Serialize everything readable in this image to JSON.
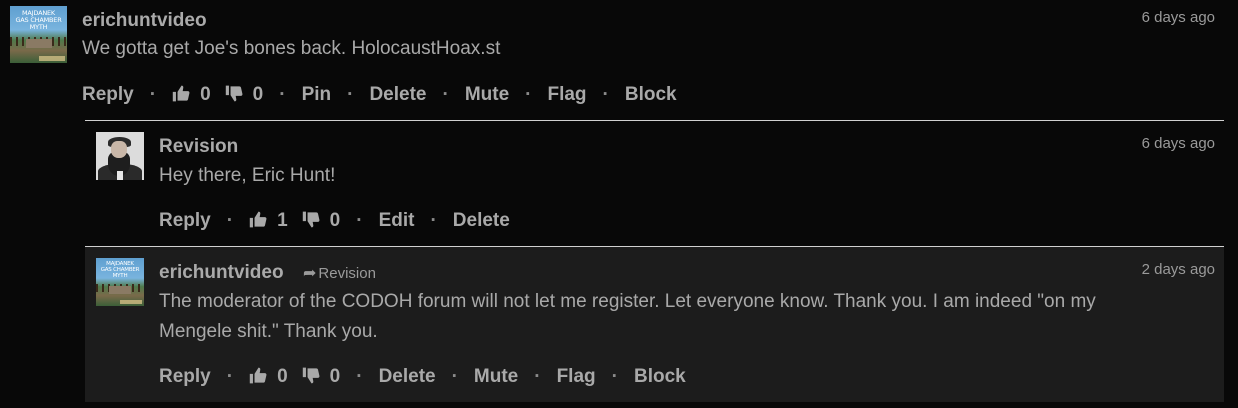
{
  "comments": [
    {
      "author": "erichuntvideo",
      "time": "6 days ago",
      "text": "We gotta get Joe's bones back. HolocaustHoax.st",
      "avatar_lines": [
        "MAJDANEK",
        "GAS CHAMBER",
        "MYTH"
      ],
      "actions": {
        "reply": "Reply",
        "likes": "0",
        "dislikes": "0",
        "pin": "Pin",
        "delete": "Delete",
        "mute": "Mute",
        "flag": "Flag",
        "block": "Block"
      }
    },
    {
      "author": "Revision",
      "time": "6 days ago",
      "text": "Hey there, Eric Hunt!",
      "actions": {
        "reply": "Reply",
        "likes": "1",
        "dislikes": "0",
        "edit": "Edit",
        "delete": "Delete"
      }
    },
    {
      "author": "erichuntvideo",
      "reply_to": "Revision",
      "time": "2 days ago",
      "text_lines": [
        "The moderator of the CODOH forum will not let me register. Let everyone know. Thank you. I am indeed \"on my",
        "Mengele shit.\" Thank you."
      ],
      "avatar_lines": [
        "MAJDANEK",
        "GAS CHAMBER",
        "MYTH"
      ],
      "actions": {
        "reply": "Reply",
        "likes": "0",
        "dislikes": "0",
        "delete": "Delete",
        "mute": "Mute",
        "flag": "Flag",
        "block": "Block"
      }
    }
  ],
  "separator": "·",
  "icons": {
    "like": "thumbs-up-icon",
    "dislike": "thumbs-down-icon",
    "reply_arrow": "reply-arrow-icon"
  },
  "colors": {
    "background": "#080808",
    "nested_reply_background": "#1c1c1c",
    "text": "#a9a9a9",
    "divider": "#d0d0d0"
  }
}
